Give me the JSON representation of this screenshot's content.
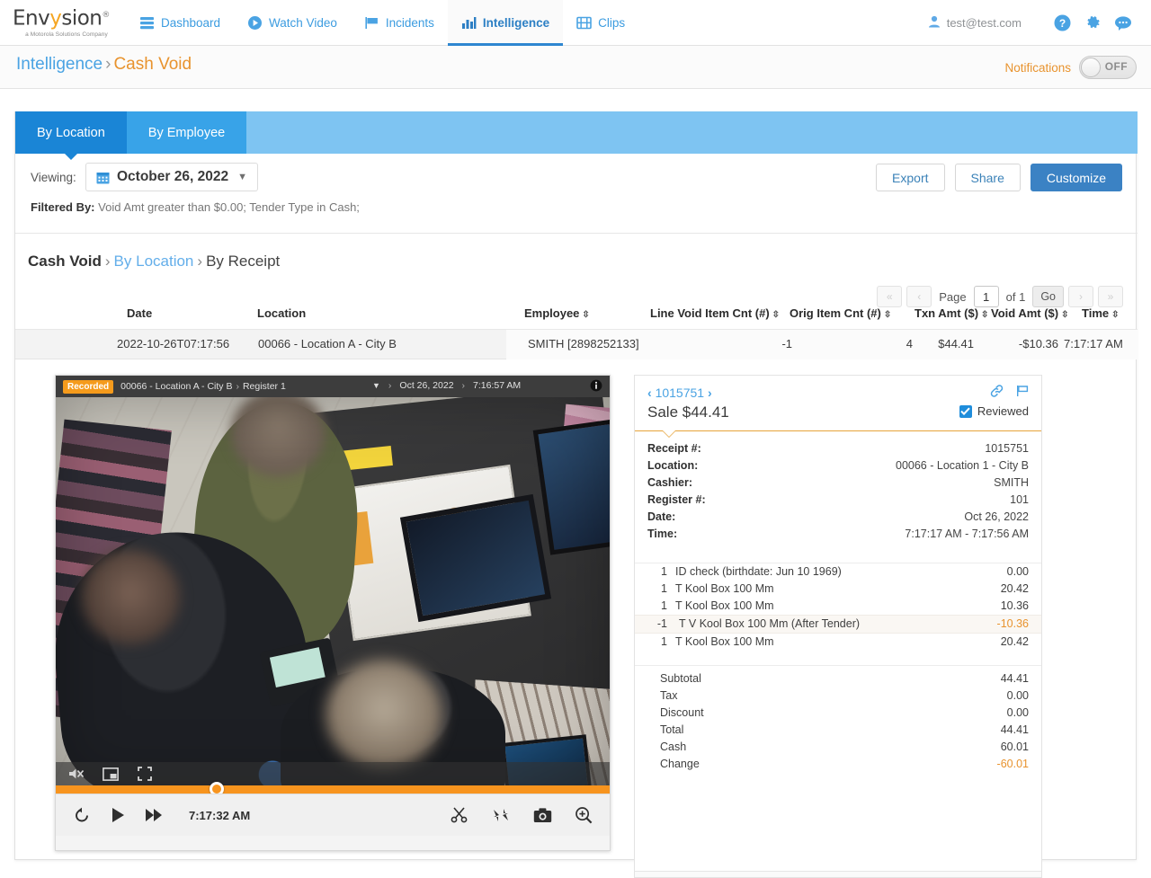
{
  "app": {
    "logo_text": "Envysion",
    "logo_tagline": "a Motorola Solutions Company",
    "nav": [
      {
        "label": "Dashboard",
        "icon": "dashboard-icon",
        "active": false
      },
      {
        "label": "Watch Video",
        "icon": "play-circle-icon",
        "active": false
      },
      {
        "label": "Incidents",
        "icon": "flag-icon",
        "active": false
      },
      {
        "label": "Intelligence",
        "icon": "bar-chart-icon",
        "active": true
      },
      {
        "label": "Clips",
        "icon": "film-icon",
        "active": false
      }
    ],
    "user_email": "test@test.com",
    "help_icon": "help-icon",
    "settings_icon": "gear-icon",
    "chat_icon": "chat-icon"
  },
  "breadcrumb": {
    "root": "Intelligence",
    "separator": "›",
    "current": "Cash Void"
  },
  "notifications": {
    "label": "Notifications",
    "state": "OFF"
  },
  "tabs": [
    {
      "label": "By Location",
      "selected": true
    },
    {
      "label": "By Employee",
      "selected": false
    }
  ],
  "toolbar": {
    "viewing_label": "Viewing:",
    "date_value": "October 26, 2022",
    "calendar_icon": "calendar-icon",
    "chevron_icon": "chevron-down-icon",
    "export_label": "Export",
    "share_label": "Share",
    "customize_label": "Customize"
  },
  "filter": {
    "label": "Filtered By:",
    "value": "Void Amt greater than $0.00; Tender Type in Cash;"
  },
  "subcrumb": {
    "title": "Cash Void",
    "sep": "›",
    "link": "By Location",
    "current": "By Receipt"
  },
  "pager": {
    "first": "«",
    "prev": "‹",
    "page_label": "Page",
    "page_value": "1",
    "of_label": "of 1",
    "go_label": "Go",
    "next": "›",
    "last": "»"
  },
  "table": {
    "columns": [
      {
        "label": "Date",
        "sortable": false
      },
      {
        "label": "Location",
        "sortable": false
      },
      {
        "label": "Employee",
        "sortable": true
      },
      {
        "label": "Line Void Item Cnt (#)",
        "sortable": true
      },
      {
        "label": "Orig Item Cnt (#)",
        "sortable": true
      },
      {
        "label": "Txn Amt ($)",
        "sortable": true
      },
      {
        "label": "Void Amt ($)",
        "sortable": true
      },
      {
        "label": "Time",
        "sortable": true
      }
    ],
    "rows": [
      {
        "date": "2022-10-26T07:17:56",
        "location": "00066 - Location A - City B",
        "employee": "SMITH [2898252133]",
        "line_void_item_cnt": "-1",
        "orig_item_cnt": "4",
        "txn_amt": "$44.41",
        "void_amt": "-$10.36",
        "time": "7:17:17 AM"
      }
    ]
  },
  "video": {
    "badge": "Recorded",
    "location": "00066 - Location A - City B",
    "sep": "›",
    "camera": "Register 1",
    "date": "Oct 26, 2022",
    "time": "7:16:57 AM",
    "info_icon": "info-icon",
    "chevron_icon": "chevron-down-icon",
    "overlay_controls": [
      {
        "name": "mute-icon"
      },
      {
        "name": "picture-in-picture-icon"
      },
      {
        "name": "fullscreen-icon"
      }
    ],
    "current_time": "7:17:32 AM",
    "controls_left": [
      {
        "name": "rewind-icon"
      },
      {
        "name": "play-icon"
      },
      {
        "name": "fast-forward-icon"
      }
    ],
    "controls_right": [
      {
        "name": "scissors-icon"
      },
      {
        "name": "collapse-icon"
      },
      {
        "name": "camera-icon"
      },
      {
        "name": "zoom-in-icon"
      }
    ]
  },
  "receipt": {
    "id": "1015751",
    "prev_icon": "chevron-left-icon",
    "next_icon": "chevron-right-icon",
    "title": "Sale $44.41",
    "link_icon": "link-icon",
    "flag_icon": "flag-icon",
    "reviewed_label": "Reviewed",
    "reviewed_checked": true,
    "meta": [
      {
        "label": "Receipt #:",
        "value": "1015751"
      },
      {
        "label": "Location:",
        "value": "00066 - Location 1 - City B"
      },
      {
        "label": "Cashier:",
        "value": "SMITH"
      },
      {
        "label": "Register #:",
        "value": "101"
      },
      {
        "label": "Date:",
        "value": "Oct 26, 2022"
      },
      {
        "label": "Time:",
        "value": "7:17:17 AM - 7:17:56 AM"
      }
    ],
    "lines": [
      {
        "qty": "1",
        "name": "ID check (birthdate: Jun 10 1969)",
        "amount": "0.00",
        "void": false
      },
      {
        "qty": "1",
        "name": "T Kool Box 100 Mm",
        "amount": "20.42",
        "void": false
      },
      {
        "qty": "1",
        "name": "T Kool Box 100 Mm",
        "amount": "10.36",
        "void": false
      },
      {
        "qty": "-1",
        "name": "T V Kool Box 100 Mm (After Tender)",
        "amount": "-10.36",
        "void": true
      },
      {
        "qty": "1",
        "name": "T Kool Box 100 Mm",
        "amount": "20.42",
        "void": false
      }
    ],
    "totals": [
      {
        "label": "Subtotal",
        "value": "44.41",
        "neg": false
      },
      {
        "label": "Tax",
        "value": "0.00",
        "neg": false
      },
      {
        "label": "Discount",
        "value": "0.00",
        "neg": false
      },
      {
        "label": "Total",
        "value": "44.41",
        "neg": false
      },
      {
        "label": "Cash",
        "value": "60.01",
        "neg": false
      },
      {
        "label": "Change",
        "value": "-60.01",
        "neg": true
      }
    ]
  },
  "colors": {
    "brand_blue": "#2e86d0",
    "accent_orange": "#e8932e",
    "tab_blue": "#1a85d6",
    "tab_strip": "#7ec4f2"
  }
}
